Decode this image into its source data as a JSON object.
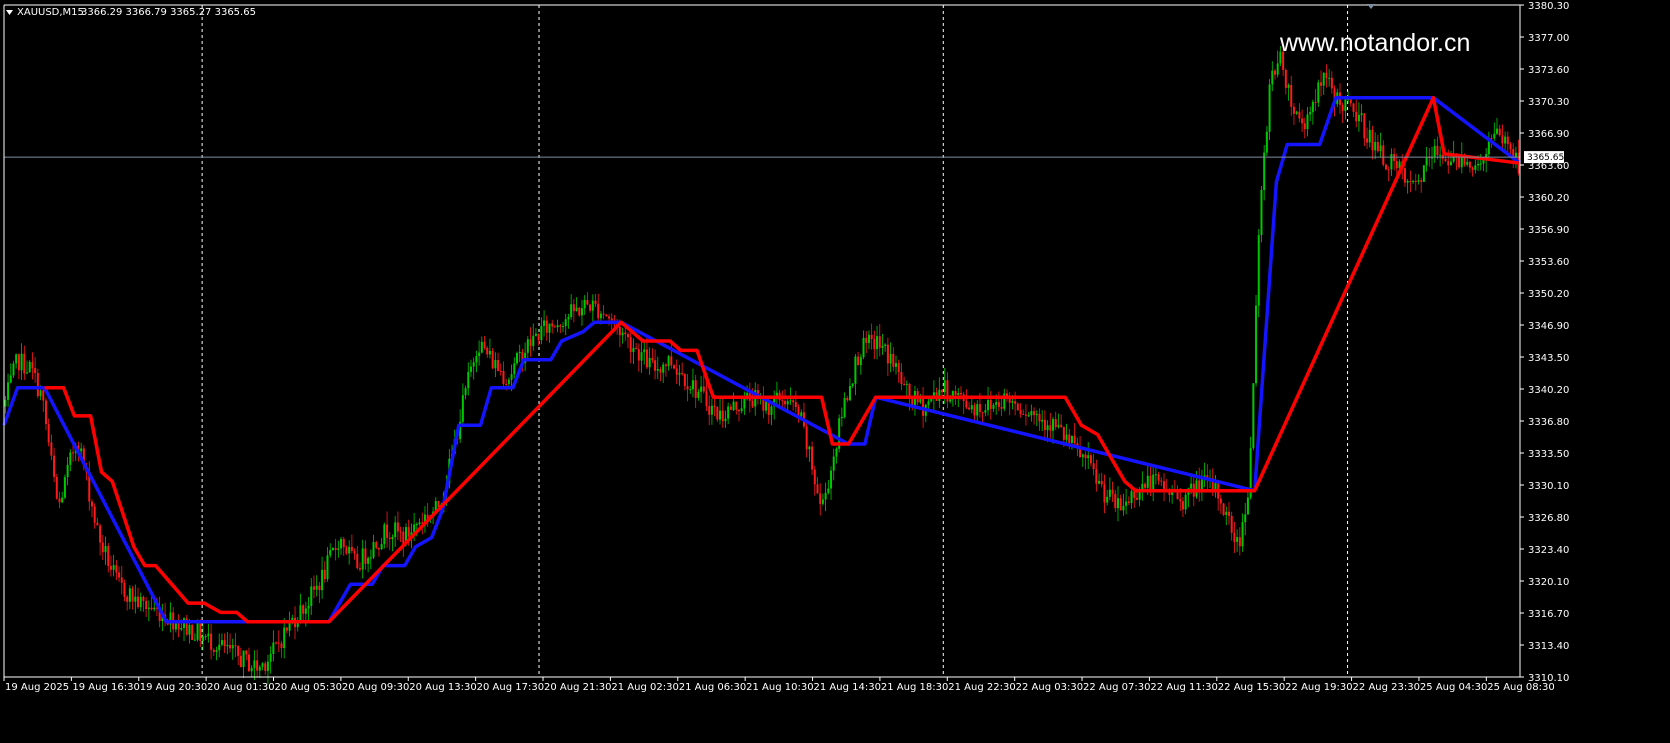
{
  "header": {
    "symbol": "XAUUSD,M15",
    "ohlc": "3366.29 3366.79 3365.27 3365.65"
  },
  "watermark": "www.notandor.cn",
  "current_price_label": "3365.65",
  "colors": {
    "background": "#000000",
    "bull_candle": "#00c800",
    "bear_candle": "#ff1a1a",
    "indicator_up": "#1414ff",
    "indicator_down": "#ff0000",
    "grid": "#ffffff",
    "current_price_line": "#7f8ea0"
  },
  "chart_data": {
    "type": "line",
    "instrument": "XAUUSD",
    "timeframe": "M15",
    "ylim": [
      3310.1,
      3381.9
    ],
    "y_ticks": [
      "3380.30",
      "3377.00",
      "3373.60",
      "3370.30",
      "3366.90",
      "3363.60",
      "3360.20",
      "3356.90",
      "3353.60",
      "3350.20",
      "3346.90",
      "3343.50",
      "3340.20",
      "3336.80",
      "3333.50",
      "3330.10",
      "3326.80",
      "3323.40",
      "3320.10",
      "3316.70",
      "3313.40",
      "3310.10"
    ],
    "x_ticks": [
      "19 Aug 2025",
      "19 Aug 16:30",
      "19 Aug 20:30",
      "20 Aug 01:30",
      "20 Aug 05:30",
      "20 Aug 09:30",
      "20 Aug 13:30",
      "20 Aug 17:30",
      "20 Aug 21:30",
      "21 Aug 02:30",
      "21 Aug 06:30",
      "21 Aug 10:30",
      "21 Aug 14:30",
      "21 Aug 18:30",
      "21 Aug 22:30",
      "22 Aug 03:30",
      "22 Aug 07:30",
      "22 Aug 11:30",
      "22 Aug 15:30",
      "22 Aug 19:30",
      "22 Aug 23:30",
      "25 Aug 04:30",
      "25 Aug 08:30"
    ],
    "day_separators": [
      "20 Aug 01:30",
      "20 Aug 21:30",
      "21 Aug 22:30",
      "22 Aug 23:30"
    ],
    "current_price": 3365.65,
    "price_path": [
      [
        0,
        3339
      ],
      [
        5,
        3344
      ],
      [
        10,
        3343
      ],
      [
        14,
        3340
      ],
      [
        20,
        3328
      ],
      [
        27,
        3336
      ],
      [
        35,
        3325
      ],
      [
        42,
        3320
      ],
      [
        50,
        3318
      ],
      [
        58,
        3317
      ],
      [
        64,
        3316
      ],
      [
        70,
        3315
      ],
      [
        76,
        3314
      ],
      [
        82,
        3313
      ],
      [
        88,
        3312
      ],
      [
        94,
        3311
      ],
      [
        100,
        3313
      ],
      [
        106,
        3316
      ],
      [
        112,
        3318
      ],
      [
        118,
        3321
      ],
      [
        124,
        3325
      ],
      [
        130,
        3322
      ],
      [
        136,
        3324
      ],
      [
        142,
        3326
      ],
      [
        148,
        3325
      ],
      [
        154,
        3327
      ],
      [
        160,
        3328
      ],
      [
        165,
        3333
      ],
      [
        170,
        3340
      ],
      [
        175,
        3346
      ],
      [
        180,
        3344
      ],
      [
        186,
        3342
      ],
      [
        192,
        3345
      ],
      [
        198,
        3347
      ],
      [
        204,
        3348
      ],
      [
        210,
        3349
      ],
      [
        216,
        3350
      ],
      [
        222,
        3349
      ],
      [
        228,
        3347
      ],
      [
        234,
        3345
      ],
      [
        240,
        3343
      ],
      [
        246,
        3344
      ],
      [
        252,
        3342
      ],
      [
        258,
        3340
      ],
      [
        264,
        3338
      ],
      [
        270,
        3339
      ],
      [
        276,
        3340
      ],
      [
        282,
        3339
      ],
      [
        288,
        3340
      ],
      [
        294,
        3338
      ],
      [
        298,
        3333
      ],
      [
        302,
        3328
      ],
      [
        306,
        3333
      ],
      [
        310,
        3339
      ],
      [
        316,
        3345
      ],
      [
        322,
        3346
      ],
      [
        328,
        3344
      ],
      [
        334,
        3340
      ],
      [
        340,
        3339
      ],
      [
        346,
        3341
      ],
      [
        352,
        3340
      ],
      [
        358,
        3339
      ],
      [
        364,
        3339
      ],
      [
        370,
        3340
      ],
      [
        376,
        3339
      ],
      [
        382,
        3338
      ],
      [
        388,
        3337
      ],
      [
        394,
        3335
      ],
      [
        400,
        3333
      ],
      [
        406,
        3330
      ],
      [
        412,
        3328
      ],
      [
        418,
        3330
      ],
      [
        424,
        3331
      ],
      [
        430,
        3330
      ],
      [
        436,
        3329
      ],
      [
        442,
        3331
      ],
      [
        448,
        3330
      ],
      [
        452,
        3327
      ],
      [
        456,
        3324
      ],
      [
        460,
        3331
      ],
      [
        464,
        3360
      ],
      [
        468,
        3375
      ],
      [
        472,
        3376
      ],
      [
        476,
        3371
      ],
      [
        480,
        3369
      ],
      [
        484,
        3372
      ],
      [
        488,
        3374
      ],
      [
        492,
        3372
      ],
      [
        496,
        3371
      ],
      [
        500,
        3370
      ],
      [
        504,
        3368
      ],
      [
        508,
        3366
      ],
      [
        512,
        3365
      ],
      [
        516,
        3364
      ],
      [
        520,
        3362
      ],
      [
        524,
        3364
      ],
      [
        528,
        3366
      ],
      [
        532,
        3366
      ],
      [
        536,
        3365
      ],
      [
        540,
        3366
      ],
      [
        544,
        3364
      ],
      [
        548,
        3367
      ],
      [
        552,
        3368
      ],
      [
        556,
        3367
      ],
      [
        559,
        3365
      ]
    ],
    "series": [
      {
        "color": "#1414ff",
        "points": [
          [
            0,
            3337
          ],
          [
            5,
            3341
          ],
          [
            15,
            3341
          ],
          [
            60,
            3316
          ],
          [
            120,
            3316
          ],
          [
            128,
            3320
          ],
          [
            136,
            3320
          ],
          [
            140,
            3322
          ],
          [
            148,
            3322
          ],
          [
            152,
            3324
          ],
          [
            158,
            3325
          ],
          [
            162,
            3328
          ],
          [
            168,
            3337
          ],
          [
            176,
            3337
          ],
          [
            180,
            3341
          ],
          [
            188,
            3341
          ],
          [
            192,
            3344
          ],
          [
            202,
            3344
          ],
          [
            206,
            3346
          ],
          [
            214,
            3347
          ],
          [
            218,
            3348
          ],
          [
            228,
            3348
          ],
          [
            312,
            3335
          ],
          [
            318,
            3335
          ],
          [
            322,
            3340
          ],
          [
            462,
            3330
          ],
          [
            470,
            3363
          ],
          [
            474,
            3367
          ],
          [
            486,
            3367
          ],
          [
            492,
            3372
          ],
          [
            528,
            3372
          ],
          [
            560,
            3365
          ]
        ]
      },
      {
        "color": "#ff0000",
        "points": [
          [
            15,
            3341
          ],
          [
            22,
            3341
          ],
          [
            26,
            3338
          ],
          [
            32,
            3338
          ],
          [
            36,
            3332
          ],
          [
            40,
            3331
          ],
          [
            48,
            3324
          ],
          [
            52,
            3322
          ],
          [
            56,
            3322
          ],
          [
            62,
            3320
          ],
          [
            68,
            3318
          ],
          [
            74,
            3318
          ],
          [
            80,
            3317
          ],
          [
            86,
            3317
          ],
          [
            90,
            3316
          ],
          [
            120,
            3316
          ],
          [
            228,
            3348
          ],
          [
            236,
            3346
          ],
          [
            246,
            3346
          ],
          [
            250,
            3345
          ],
          [
            256,
            3345
          ],
          [
            262,
            3340
          ],
          [
            302,
            3340
          ],
          [
            306,
            3335
          ],
          [
            312,
            3335
          ],
          [
            322,
            3340
          ],
          [
            392,
            3340
          ],
          [
            398,
            3337
          ],
          [
            404,
            3336
          ],
          [
            410,
            3333
          ],
          [
            414,
            3331
          ],
          [
            418,
            3330
          ],
          [
            462,
            3330
          ],
          [
            528,
            3372
          ],
          [
            532,
            3366
          ],
          [
            560,
            3365
          ]
        ]
      }
    ]
  }
}
